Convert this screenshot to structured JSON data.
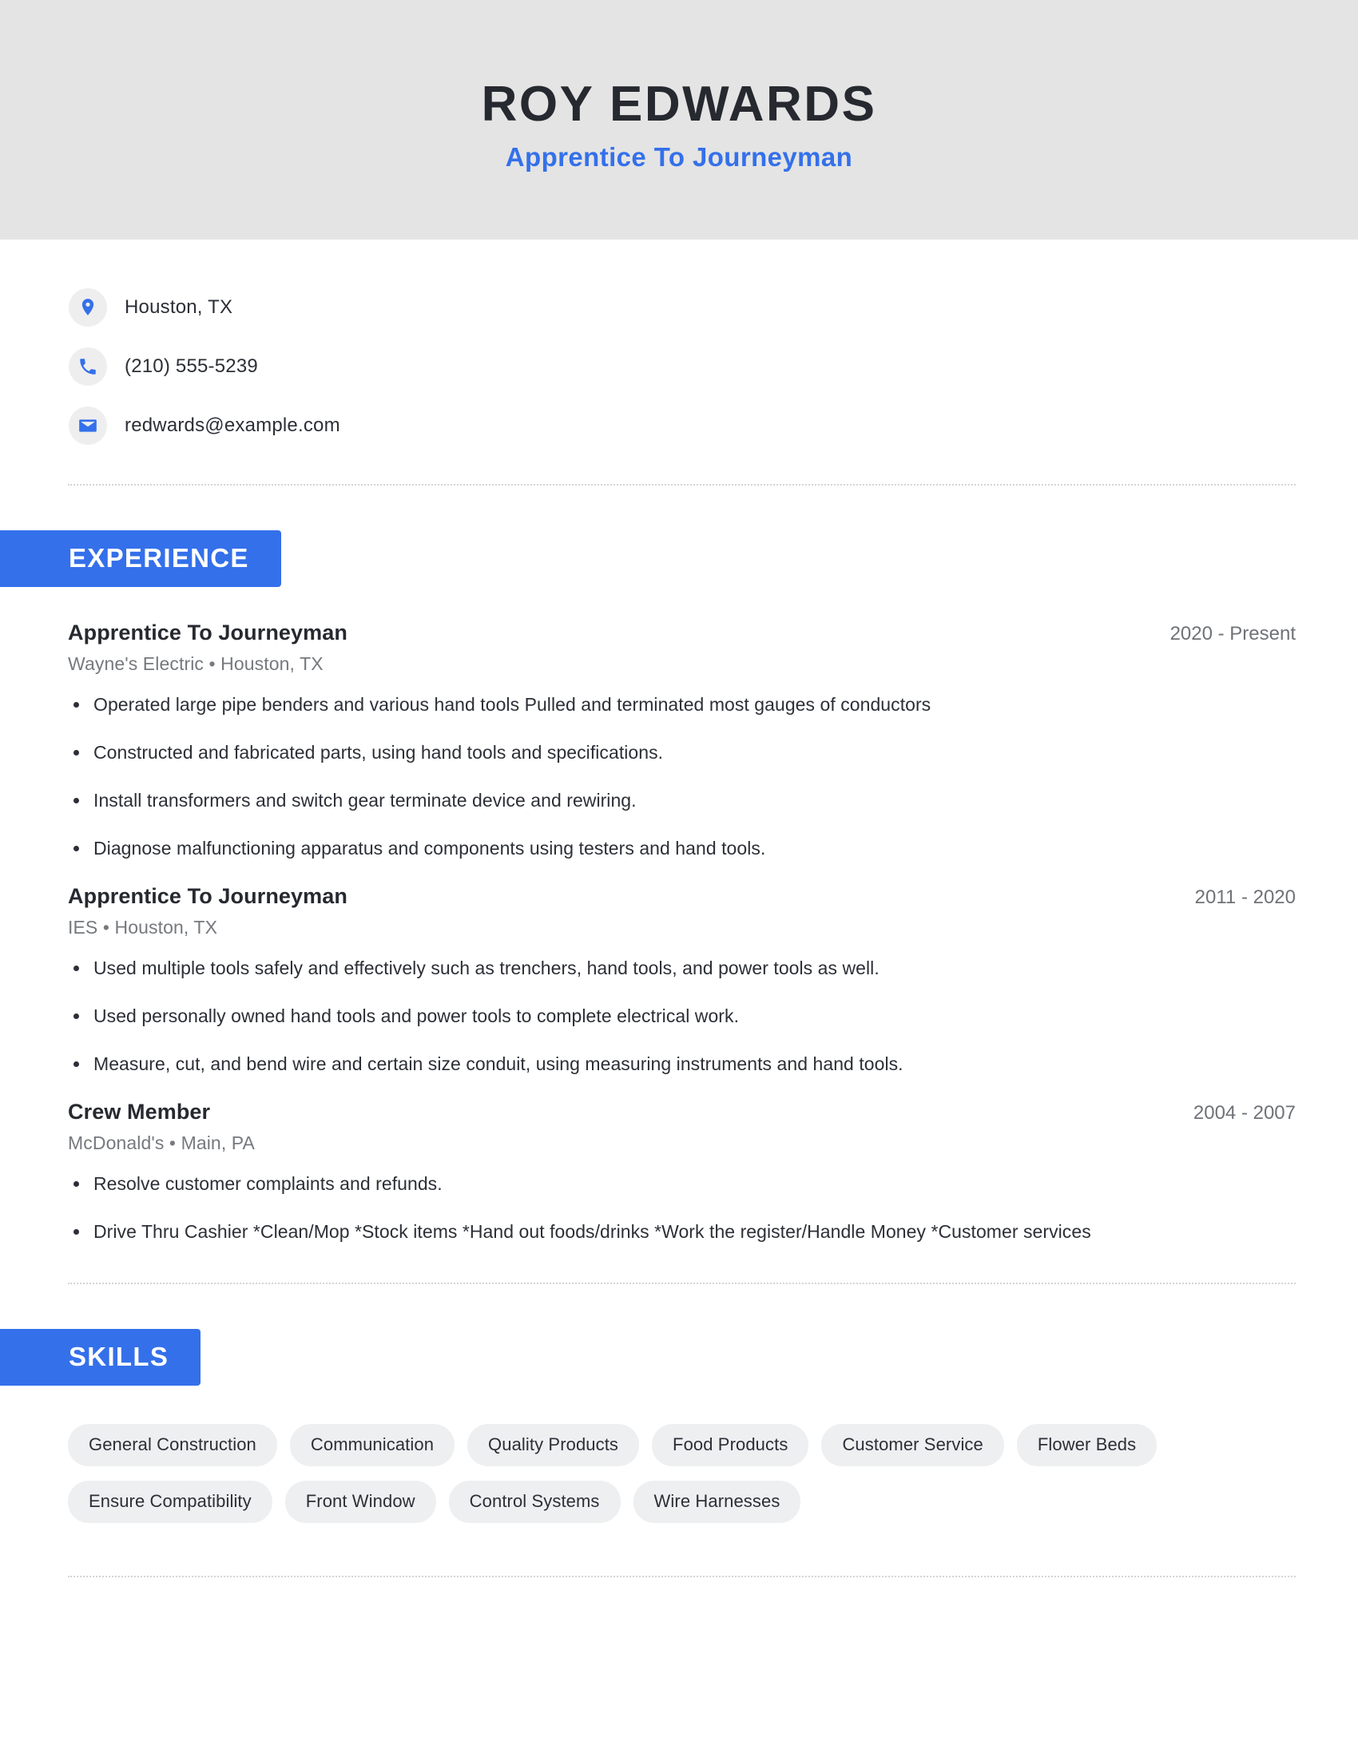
{
  "colors": {
    "accent": "#3470ea",
    "header_background": "#e4e4e4",
    "text_dark": "#26292f",
    "text_muted": "#76797e",
    "chip_background": "#eeeff1"
  },
  "header": {
    "name": "ROY EDWARDS",
    "title": "Apprentice To Journeyman"
  },
  "contact": {
    "items": [
      {
        "icon": "location-pin-icon",
        "value": "Houston, TX"
      },
      {
        "icon": "phone-icon",
        "value": "(210) 555-5239"
      },
      {
        "icon": "envelope-icon",
        "value": "redwards@example.com"
      }
    ]
  },
  "sections": {
    "experience": {
      "heading": "EXPERIENCE",
      "jobs": [
        {
          "title": "Apprentice To Journeyman",
          "dates": "2020 - Present",
          "company": "Wayne's Electric",
          "location": "Houston, TX",
          "meta": "Wayne's Electric  •  Houston, TX",
          "bullets": [
            "Operated large pipe benders and various hand tools Pulled and terminated most gauges of conductors",
            "Constructed and fabricated parts, using hand tools and specifications.",
            "Install transformers and switch gear terminate device and rewiring.",
            "Diagnose malfunctioning apparatus and components using testers and hand tools."
          ]
        },
        {
          "title": "Apprentice To Journeyman",
          "dates": "2011 - 2020",
          "company": "IES",
          "location": "Houston, TX",
          "meta": "IES  •  Houston, TX",
          "bullets": [
            "Used multiple tools safely and effectively such as trenchers, hand tools, and power tools as well.",
            "Used personally owned hand tools and power tools to complete electrical work.",
            "Measure, cut, and bend wire and certain size conduit, using measuring instruments and hand tools."
          ]
        },
        {
          "title": "Crew Member",
          "dates": "2004 - 2007",
          "company": "McDonald's",
          "location": "Main, PA",
          "meta": "McDonald's  •  Main, PA",
          "bullets": [
            "Resolve customer complaints and refunds.",
            "Drive Thru Cashier *Clean/Mop *Stock items *Hand out foods/drinks *Work the register/Handle Money *Customer services"
          ]
        }
      ]
    },
    "skills": {
      "heading": "SKILLS",
      "items": [
        "General Construction",
        "Communication",
        "Quality Products",
        "Food Products",
        "Customer Service",
        "Flower Beds",
        "Ensure Compatibility",
        "Front Window",
        "Control Systems",
        "Wire Harnesses"
      ]
    }
  }
}
